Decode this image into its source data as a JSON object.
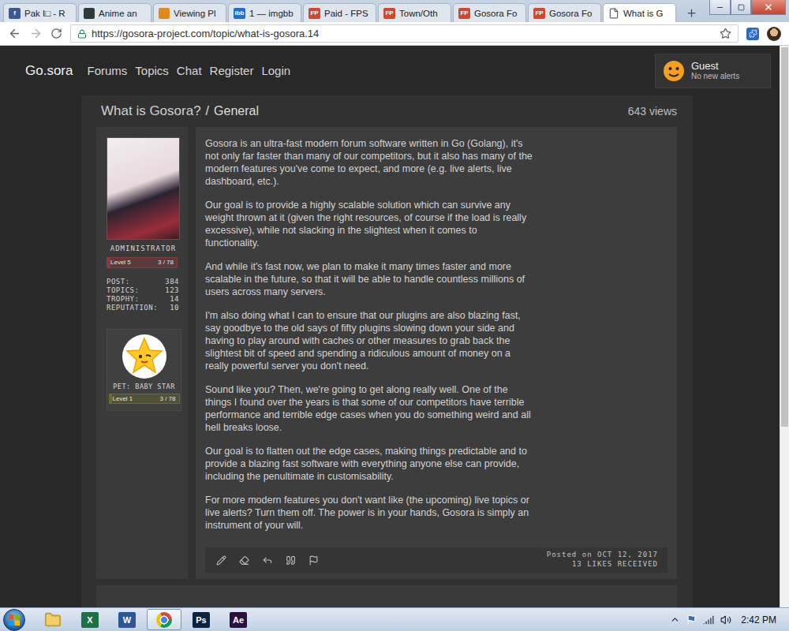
{
  "browser": {
    "tabs": [
      {
        "label": "Pak I□ - R",
        "kind": "badge",
        "badge": "f",
        "color": "#3b5998",
        "selected": false
      },
      {
        "label": "Anime an",
        "kind": "image",
        "color": "#2f3b3a",
        "selected": false
      },
      {
        "label": "Viewing Pl",
        "kind": "image",
        "color": "#e08a1e",
        "selected": false
      },
      {
        "label": "1 — imgbb",
        "kind": "badge",
        "badge": "ibb",
        "color": "#1d6fd6",
        "selected": false
      },
      {
        "label": "Paid - FPS",
        "kind": "badge",
        "badge": "FP",
        "color": "#d6452c",
        "selected": false
      },
      {
        "label": "Town/Oth",
        "kind": "badge",
        "badge": "FP",
        "color": "#d6452c",
        "selected": false
      },
      {
        "label": "Gosora Fo",
        "kind": "badge",
        "badge": "FP",
        "color": "#d6452c",
        "selected": false
      },
      {
        "label": "Gosora Fo",
        "kind": "badge",
        "badge": "FP",
        "color": "#d6452c",
        "selected": false
      },
      {
        "label": "What is G",
        "kind": "page",
        "color": "#5f6368",
        "selected": true
      }
    ],
    "url": "https://gosora-project.com/topic/what-is-gosora.14",
    "scrollbar": {
      "level": 0.68
    }
  },
  "site": {
    "logo": "Go.sora",
    "nav": [
      "Forums",
      "Topics",
      "Chat",
      "Register",
      "Login"
    ],
    "alerts": {
      "user": "Guest",
      "message": "No new alerts"
    }
  },
  "topic": {
    "title": "What is Gosora?",
    "separator": "/",
    "forum": "General",
    "views": "643 views"
  },
  "post": {
    "author": {
      "title": "ADMINISTRATOR",
      "level": {
        "label": "Level 5",
        "progress": "3 / 78",
        "level": 0.04,
        "color": "#8c3b3b"
      },
      "stats": [
        {
          "label": "POST:",
          "value": "384"
        },
        {
          "label": "TOPICS:",
          "value": "123"
        },
        {
          "label": "TROPHY:",
          "value": "14"
        },
        {
          "label": "REPUTATION:",
          "value": "10"
        }
      ]
    },
    "pet": {
      "name": "PET: BABY STAR",
      "level": {
        "label": "Level 1",
        "progress": "3 / 78",
        "level": 0.04,
        "color": "#6b6b2e"
      }
    },
    "paragraphs": [
      "Gosora is an ultra-fast modern forum software written in Go (Golang), it's not only far faster than many of our competitors, but it also has many of the modern features you've come to expect, and more (e.g. live alerts, live dashboard, etc.).",
      "Our goal is to provide a highly scalable solution which can survive any weight thrown at it (given the right resources, of course if the load is really excessive), while not slacking in the slightest when it comes to functionality.",
      "And while it's fast now, we plan to make it many times faster and more scalable in the future, so that it will be able to handle countless millions of users across many servers.",
      "I'm also doing what I can to ensure that our plugins are also blazing fast, say goodbye to the old says of fifty plugins slowing down your side and having to play around with caches or other measures to grab back the slightest bit of speed and spending a ridiculous amount of money on a really powerful server you don't need.",
      "Sound like you? Then, we're going to get along really well. One of the things I found over the years is that some of our competitors have terrible performance and terrible edge cases when you do something weird and all hell breaks loose.",
      "Our goal is to flatten out the edge cases, making things predictable and to provide a blazing fast software with everything anyone else can provide, including the penultimate in customisability.",
      "For more modern features you don't want like (the upcoming) live topics or live alerts? Turn them off. The power is in your hands, Gosora is simply an instrument of your will."
    ],
    "posted": "Posted on OCT 12, 2017",
    "likes": "13 LIKES RECEIVED"
  },
  "taskbar": {
    "apps": [
      {
        "kind": "folder",
        "selected": false
      },
      {
        "kind": "letter",
        "label": "X",
        "color": "#1e7145",
        "selected": false
      },
      {
        "kind": "letter",
        "label": "W",
        "color": "#2b5797",
        "selected": false
      },
      {
        "kind": "chrome",
        "selected": true
      },
      {
        "kind": "letter",
        "label": "Ps",
        "color": "#0c2340",
        "selected": false
      },
      {
        "kind": "letter",
        "label": "Ae",
        "color": "#2a1040",
        "selected": false
      }
    ],
    "clock": "2:42 PM"
  }
}
